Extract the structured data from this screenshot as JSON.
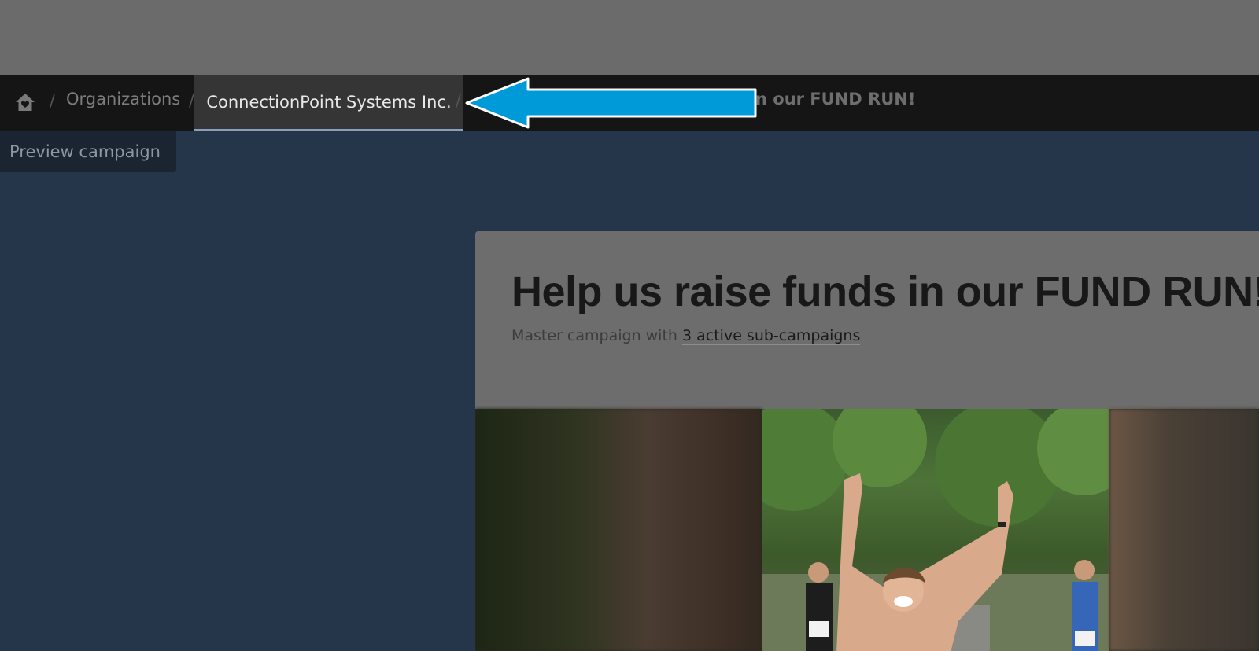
{
  "breadcrumb": {
    "home_icon": "home-heart-icon",
    "separator": "/",
    "items": [
      {
        "label": "Organizations"
      },
      {
        "label": "ConnectionPoint Systems Inc."
      },
      {
        "label": "Help us raise funds in our FUND RUN!"
      }
    ],
    "visible_tail": "n our FUND RUN!"
  },
  "preview_tab": {
    "label": "Preview campaign"
  },
  "campaign": {
    "title": "Help us raise funds in our FUND RUN!",
    "subtitle_prefix": "Master campaign with",
    "subtitle_link": "3 active sub-campaigns"
  },
  "annotation": {
    "arrow_color": "#009ad8",
    "arrow_icon": "left-arrow-icon"
  },
  "colors": {
    "overlay_gray": "#6b6b6b",
    "breadcrumb_bg": "#151515",
    "page_bg": "#26364a"
  }
}
